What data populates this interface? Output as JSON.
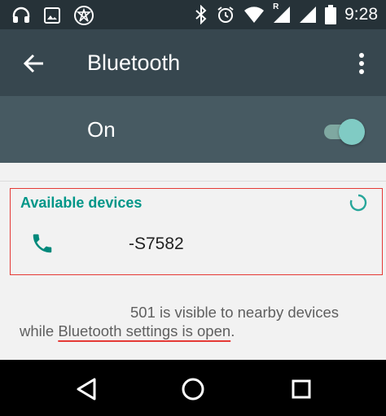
{
  "status_bar": {
    "time": "9:28",
    "icons": [
      "headphones-icon",
      "image-icon",
      "no-signal-app-icon",
      "bluetooth-icon",
      "alarm-icon",
      "wifi-icon",
      "signal-roaming-icon",
      "signal-icon",
      "battery-icon"
    ],
    "roaming_glyph": "R"
  },
  "app_bar": {
    "title": "Bluetooth",
    "back_icon": "arrow-back-icon",
    "menu_icon": "more-vert-icon"
  },
  "toggle": {
    "label": "On",
    "state": true,
    "accent": "#80cbc4"
  },
  "available_devices": {
    "header": "Available devices",
    "scanning": true,
    "devices": [
      {
        "name": "-S7582",
        "icon": "phone-icon"
      }
    ]
  },
  "visibility": {
    "line1": "501 is visible to nearby devices",
    "line2_prefix": "while ",
    "line2_underlined": "Bluetooth settings is open",
    "line2_suffix": "."
  },
  "nav_bar": {
    "buttons": [
      "back-triangle-icon",
      "home-circle-icon",
      "recents-square-icon"
    ]
  },
  "colors": {
    "accent": "#009688",
    "app_bar": "#37474f",
    "toggle_bar": "#475a62",
    "highlight": "#e53935"
  }
}
